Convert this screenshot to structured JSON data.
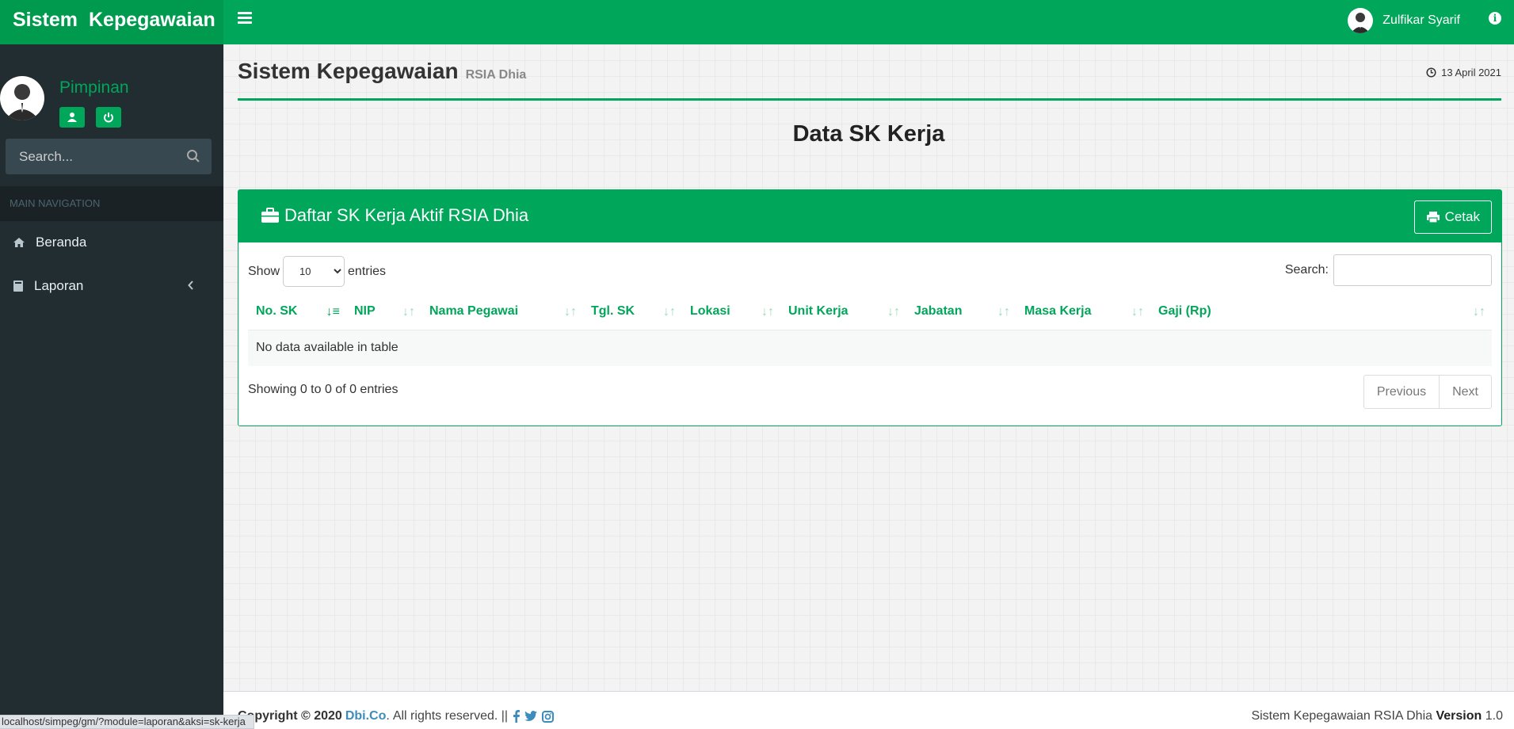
{
  "header": {
    "app_name_part1": "Sistem",
    "app_name_part2": "Kepegawaian",
    "user_name": "Zulfikar Syarif",
    "menu_icon": "hamburger-icon",
    "info_icon": "info-icon"
  },
  "sidebar": {
    "role": "Pimpinan",
    "search_placeholder": "Search...",
    "nav_header": "MAIN NAVIGATION",
    "items": [
      {
        "label": "Beranda",
        "icon": "home-icon"
      },
      {
        "label": "Laporan",
        "icon": "book-icon"
      }
    ]
  },
  "page": {
    "title": "Sistem Kepegawaian",
    "subtitle": "RSIA Dhia",
    "date": "13 April 2021",
    "section_title": "Data SK Kerja"
  },
  "box": {
    "title": "Daftar SK Kerja Aktif RSIA Dhia",
    "print_label": "Cetak"
  },
  "table": {
    "show_label": "Show",
    "entries_label": "entries",
    "length_value": "10",
    "search_label": "Search:",
    "columns": [
      "No. SK",
      "NIP",
      "Nama Pegawai",
      "Tgl. SK",
      "Lokasi",
      "Unit Kerja",
      "Jabatan",
      "Masa Kerja",
      "Gaji (Rp)"
    ],
    "empty_message": "No data available in table",
    "info": "Showing 0 to 0 of 0 entries",
    "prev_label": "Previous",
    "next_label": "Next"
  },
  "footer": {
    "copyright": "Copyright © 2020",
    "company": "Dbi.Co",
    "dot": ".",
    "rights": "All rights reserved. ||",
    "right_text": "Sistem Kepegawaian RSIA Dhia",
    "version_label": "Version",
    "version": "1.0"
  },
  "status_url": "localhost/simpeg/gm/?module=laporan&aksi=sk-kerja",
  "colors": {
    "accent": "#00a65a",
    "sidebar": "#222d32",
    "link": "#3c8dbc"
  }
}
